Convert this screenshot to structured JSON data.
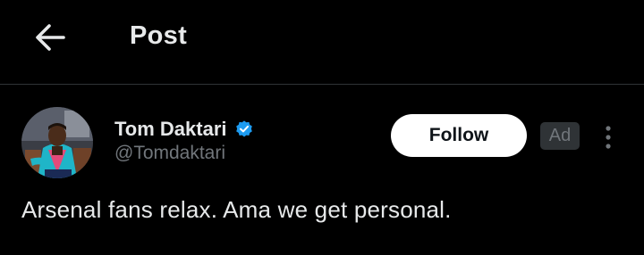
{
  "header": {
    "title": "Post",
    "back_icon": "arrow-left-icon"
  },
  "post": {
    "author": {
      "display_name": "Tom Daktari",
      "handle": "@Tomdaktari",
      "verified": true,
      "verified_color": "#1d9bf0"
    },
    "follow_label": "Follow",
    "ad_label": "Ad",
    "more_icon": "more-vertical-icon",
    "text": "Arsenal fans relax. Ama we get personal."
  },
  "colors": {
    "background": "#000000",
    "text_primary": "#e7e9ea",
    "text_secondary": "#71767b",
    "divider": "#2f3336",
    "follow_bg": "#ffffff"
  }
}
